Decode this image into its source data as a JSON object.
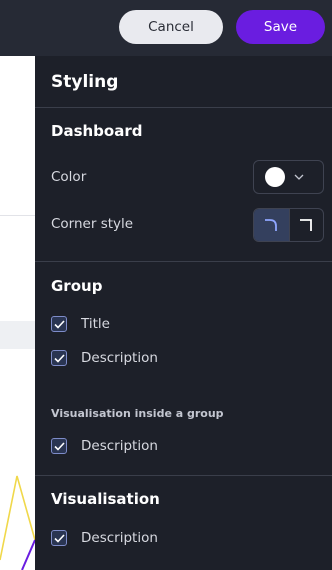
{
  "header": {
    "cancel_label": "Cancel",
    "save_label": "Save"
  },
  "colors": {
    "topbar": "#262a35",
    "panel": "#1d2029",
    "save": "#6a1de0",
    "cancel": "#e9eaef",
    "checkbox": "#7e8cc9",
    "chart_line_yellow": "#f0d84a",
    "chart_line_purple": "#6a1de0"
  },
  "panel": {
    "title": "Styling",
    "dashboard": {
      "title": "Dashboard",
      "color_label": "Color",
      "color_value": "#ffffff",
      "corner_label": "Corner style",
      "corner_options": [
        "rounded-corner-icon",
        "square-corner-icon"
      ],
      "corner_selected": "rounded"
    },
    "group": {
      "title": "Group",
      "options": [
        {
          "label": "Title",
          "checked": true
        },
        {
          "label": "Description",
          "checked": true
        }
      ],
      "sub_title": "Visualisation inside a group",
      "sub_options": [
        {
          "label": "Description",
          "checked": true
        }
      ]
    },
    "visualisation": {
      "title": "Visualisation",
      "options": [
        {
          "label": "Description",
          "checked": true
        }
      ]
    }
  }
}
